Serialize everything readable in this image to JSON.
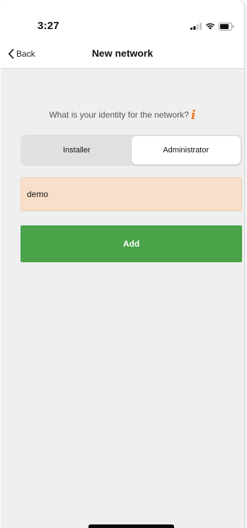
{
  "status_bar": {
    "time": "3:27",
    "icons": [
      "signal-icon",
      "wifi-icon",
      "battery-icon"
    ]
  },
  "nav": {
    "back_label": "Back",
    "title": "New network"
  },
  "identity": {
    "question": "What is your identity for the network?",
    "info_icon": "info-icon",
    "info_glyph": "i",
    "options": [
      "Installer",
      "Administrator"
    ],
    "selected": "Administrator"
  },
  "form": {
    "name_value": "demo",
    "add_label": "Add"
  },
  "colors": {
    "accent_green": "#4aa249",
    "field_background": "#f9dfc9",
    "info_orange": "#f07a2a",
    "page_background": "#efefef"
  }
}
